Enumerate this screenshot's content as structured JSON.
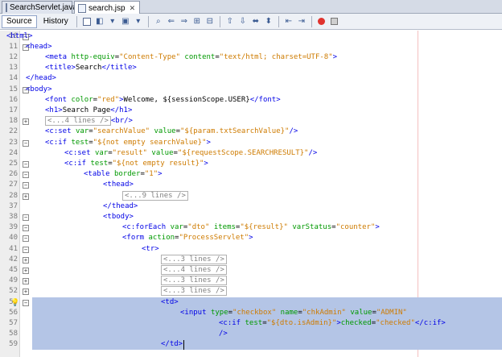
{
  "tabs": [
    {
      "label": "SearchServlet.java",
      "active": false,
      "close": "✕"
    },
    {
      "label": "search.jsp",
      "active": true,
      "close": "✕"
    }
  ],
  "toolbar": {
    "source_label": "Source",
    "history_label": "History",
    "icons": [
      "last-edit-icon",
      "back-icon",
      "forward-icon",
      "find-icon",
      "find-previous-icon",
      "find-next-icon",
      "toggle-highlight-icon",
      "toggle-rect-selection-icon",
      "prev-bookmark-icon",
      "next-bookmark-icon",
      "toggle-bookmark-icon",
      "shift-left-icon",
      "shift-right-icon",
      "comment-icon",
      "uncomment-icon",
      "start-macro-icon",
      "stop-macro-icon"
    ]
  },
  "lines": [
    {
      "num": "10",
      "fold": "−",
      "sel": false,
      "indent": 0,
      "parts": [
        [
          "tag",
          "&lt;html&gt;"
        ]
      ]
    },
    {
      "num": "11",
      "fold": "−",
      "sel": false,
      "indent": 1,
      "parts": [
        [
          "tag",
          "&lt;head&gt;"
        ]
      ]
    },
    {
      "num": "12",
      "fold": "",
      "sel": false,
      "indent": 2,
      "parts": [
        [
          "tag",
          "&lt;meta "
        ],
        [
          "attr",
          "http-equiv"
        ],
        [
          "txt",
          "="
        ],
        [
          "val",
          "\"Content-Type\""
        ],
        [
          "txt",
          " "
        ],
        [
          "attr",
          "content"
        ],
        [
          "txt",
          "="
        ],
        [
          "val",
          "\"text/html; charset=UTF-8\""
        ],
        [
          "tag",
          "&gt;"
        ]
      ]
    },
    {
      "num": "13",
      "fold": "",
      "sel": false,
      "indent": 2,
      "parts": [
        [
          "tag",
          "&lt;title&gt;"
        ],
        [
          "txt",
          "Search"
        ],
        [
          "tag",
          "&lt;/title&gt;"
        ]
      ]
    },
    {
      "num": "14",
      "fold": "",
      "sel": false,
      "indent": 1,
      "parts": [
        [
          "tag",
          "&lt;/head&gt;"
        ]
      ]
    },
    {
      "num": "15",
      "fold": "−",
      "sel": false,
      "indent": 1,
      "parts": [
        [
          "tag",
          "&lt;body&gt;"
        ]
      ]
    },
    {
      "num": "16",
      "fold": "",
      "sel": false,
      "indent": 2,
      "parts": [
        [
          "tag",
          "&lt;font "
        ],
        [
          "attr",
          "color"
        ],
        [
          "txt",
          "="
        ],
        [
          "val",
          "\"red\""
        ],
        [
          "tag",
          "&gt;"
        ],
        [
          "txt",
          "Welcome, ${sessionScope.USER}"
        ],
        [
          "tag",
          "&lt;/font&gt;"
        ]
      ]
    },
    {
      "num": "17",
      "fold": "",
      "sel": false,
      "indent": 2,
      "parts": [
        [
          "tag",
          "&lt;h1&gt;"
        ],
        [
          "txt",
          "Search Page"
        ],
        [
          "tag",
          "&lt;/h1&gt;"
        ]
      ]
    },
    {
      "num": "18",
      "fold": "+",
      "sel": false,
      "indent": 2,
      "parts": [
        [
          "collapsed",
          "&lt;...4 lines /&gt;"
        ],
        [
          "tag",
          "&lt;br/&gt;"
        ]
      ]
    },
    {
      "num": "22",
      "fold": "",
      "sel": false,
      "indent": 2,
      "parts": [
        [
          "tag",
          "&lt;c:set "
        ],
        [
          "attr",
          "var"
        ],
        [
          "txt",
          "="
        ],
        [
          "val",
          "\"searchValue\""
        ],
        [
          "txt",
          " "
        ],
        [
          "attr",
          "value"
        ],
        [
          "txt",
          "="
        ],
        [
          "val",
          "\"${param.txtSearchValue}\""
        ],
        [
          "tag",
          "/&gt;"
        ]
      ]
    },
    {
      "num": "23",
      "fold": "−",
      "sel": false,
      "indent": 2,
      "parts": [
        [
          "tag",
          "&lt;c:if "
        ],
        [
          "attr",
          "test"
        ],
        [
          "txt",
          "="
        ],
        [
          "val",
          "\"${not empty searchValue}\""
        ],
        [
          "tag",
          "&gt;"
        ]
      ]
    },
    {
      "num": "24",
      "fold": "",
      "sel": false,
      "indent": 3,
      "parts": [
        [
          "tag",
          "&lt;c:set "
        ],
        [
          "attr",
          "var"
        ],
        [
          "txt",
          "="
        ],
        [
          "val",
          "\"result\""
        ],
        [
          "txt",
          " "
        ],
        [
          "attr",
          "value"
        ],
        [
          "txt",
          "="
        ],
        [
          "val",
          "\"${requestScope.SEARCHRESULT}\""
        ],
        [
          "tag",
          "/&gt;"
        ]
      ]
    },
    {
      "num": "25",
      "fold": "−",
      "sel": false,
      "indent": 3,
      "parts": [
        [
          "tag",
          "&lt;c:if "
        ],
        [
          "attr",
          "test"
        ],
        [
          "txt",
          "="
        ],
        [
          "val",
          "\"${not empty result}\""
        ],
        [
          "tag",
          "&gt;"
        ]
      ]
    },
    {
      "num": "26",
      "fold": "−",
      "sel": false,
      "indent": 4,
      "parts": [
        [
          "tag",
          "&lt;table "
        ],
        [
          "attr",
          "border"
        ],
        [
          "txt",
          "="
        ],
        [
          "val",
          "\"1\""
        ],
        [
          "tag",
          "&gt;"
        ]
      ]
    },
    {
      "num": "27",
      "fold": "−",
      "sel": false,
      "indent": 5,
      "parts": [
        [
          "tag",
          "&lt;thead&gt;"
        ]
      ]
    },
    {
      "num": "28",
      "fold": "+",
      "sel": false,
      "indent": 6,
      "parts": [
        [
          "collapsed",
          "&lt;...9 lines /&gt;"
        ]
      ]
    },
    {
      "num": "37",
      "fold": "",
      "sel": false,
      "indent": 5,
      "parts": [
        [
          "tag",
          "&lt;/thead&gt;"
        ]
      ]
    },
    {
      "num": "38",
      "fold": "−",
      "sel": false,
      "indent": 5,
      "parts": [
        [
          "tag",
          "&lt;tbody&gt;"
        ]
      ]
    },
    {
      "num": "39",
      "fold": "−",
      "sel": false,
      "indent": 6,
      "parts": [
        [
          "tag",
          "&lt;c:forEach "
        ],
        [
          "attr",
          "var"
        ],
        [
          "txt",
          "="
        ],
        [
          "val",
          "\"dto\""
        ],
        [
          "txt",
          " "
        ],
        [
          "attr",
          "items"
        ],
        [
          "txt",
          "="
        ],
        [
          "val",
          "\"${result}\""
        ],
        [
          "txt",
          " "
        ],
        [
          "attr",
          "varStatus"
        ],
        [
          "txt",
          "="
        ],
        [
          "val",
          "\"counter\""
        ],
        [
          "tag",
          "&gt;"
        ]
      ]
    },
    {
      "num": "40",
      "fold": "−",
      "sel": false,
      "indent": 6,
      "parts": [
        [
          "tag",
          "&lt;form "
        ],
        [
          "attr",
          "action"
        ],
        [
          "txt",
          "="
        ],
        [
          "val",
          "\"ProcessServlet\""
        ],
        [
          "tag",
          "&gt;"
        ]
      ]
    },
    {
      "num": "41",
      "fold": "−",
      "sel": false,
      "indent": 7,
      "parts": [
        [
          "tag",
          "&lt;tr&gt;"
        ]
      ]
    },
    {
      "num": "42",
      "fold": "+",
      "sel": false,
      "indent": 8,
      "parts": [
        [
          "collapsed",
          "&lt;...3 lines /&gt;"
        ]
      ]
    },
    {
      "num": "45",
      "fold": "+",
      "sel": false,
      "indent": 8,
      "parts": [
        [
          "collapsed",
          "&lt;...4 lines /&gt;"
        ]
      ]
    },
    {
      "num": "49",
      "fold": "+",
      "sel": false,
      "indent": 8,
      "parts": [
        [
          "collapsed",
          "&lt;...3 lines /&gt;"
        ]
      ]
    },
    {
      "num": "52",
      "fold": "+",
      "sel": false,
      "indent": 8,
      "parts": [
        [
          "collapsed",
          "&lt;...3 lines /&gt;"
        ]
      ]
    },
    {
      "num": "55",
      "fold": "−",
      "sel": true,
      "bulb": true,
      "indent": 8,
      "parts": [
        [
          "tag",
          "&lt;td&gt;"
        ]
      ]
    },
    {
      "num": "56",
      "fold": "",
      "sel": true,
      "indent": 9,
      "parts": [
        [
          "tag",
          "&lt;input "
        ],
        [
          "attr",
          "type"
        ],
        [
          "txt",
          "="
        ],
        [
          "val",
          "\"checkbox\""
        ],
        [
          "txt",
          " "
        ],
        [
          "attr",
          "name"
        ],
        [
          "txt",
          "="
        ],
        [
          "val",
          "\"chkAdmin\""
        ],
        [
          "txt",
          " "
        ],
        [
          "attr",
          "value"
        ],
        [
          "txt",
          "="
        ],
        [
          "val",
          "\"ADMIN\""
        ]
      ]
    },
    {
      "num": "57",
      "fold": "",
      "sel": true,
      "indent": 11,
      "parts": [
        [
          "tag",
          "&lt;c:if "
        ],
        [
          "attr",
          "test"
        ],
        [
          "txt",
          "="
        ],
        [
          "val",
          "\"${dto.isAdmin}\""
        ],
        [
          "tag",
          "&gt;"
        ],
        [
          "attr",
          "checked"
        ],
        [
          "txt",
          "="
        ],
        [
          "val",
          "\"checked\""
        ],
        [
          "tag",
          "&lt;/c:if&gt;"
        ]
      ]
    },
    {
      "num": "58",
      "fold": "",
      "sel": true,
      "indent": 11,
      "parts": [
        [
          "tag",
          "/&gt;"
        ]
      ]
    },
    {
      "num": "59",
      "fold": "",
      "sel": true,
      "caret": true,
      "indent": 8,
      "parts": [
        [
          "tag",
          "&lt;/td&gt;"
        ]
      ]
    }
  ],
  "colors": {
    "tag": "#0000e6",
    "attr": "#009900",
    "value": "#ce7b00",
    "selection": "#b4c5e6"
  }
}
